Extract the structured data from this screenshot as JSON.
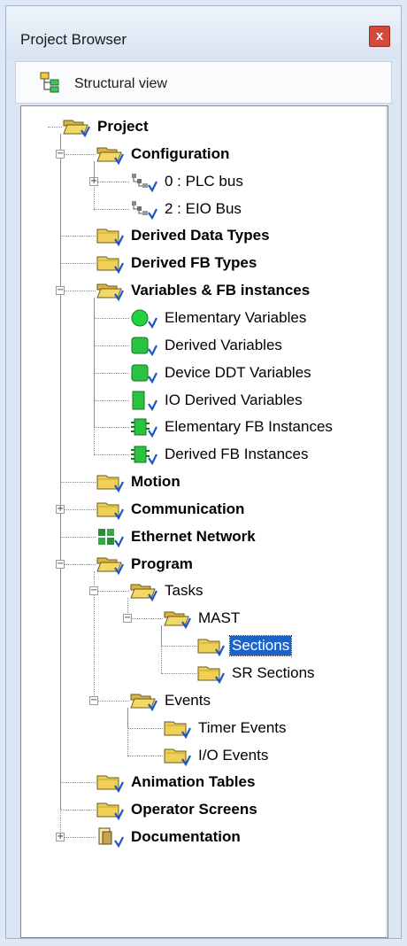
{
  "panel": {
    "title": "Project Browser",
    "close_label": "x"
  },
  "view": {
    "label": "Structural view",
    "icon": "structural-view-icon"
  },
  "tree": [
    {
      "id": "project",
      "label": "Project",
      "bold": true,
      "depth": 0,
      "icon": "folder-open",
      "expander": null
    },
    {
      "id": "configuration",
      "label": "Configuration",
      "bold": true,
      "depth": 1,
      "icon": "folder-open",
      "expander": "-"
    },
    {
      "id": "plc-bus",
      "label": "0 : PLC bus",
      "bold": false,
      "depth": 2,
      "icon": "bus",
      "expander": "+"
    },
    {
      "id": "eio-bus",
      "label": "2 : EIO Bus",
      "bold": false,
      "depth": 2,
      "icon": "bus",
      "expander": null
    },
    {
      "id": "derived-data-types",
      "label": "Derived Data Types",
      "bold": true,
      "depth": 1,
      "icon": "folder",
      "expander": null
    },
    {
      "id": "derived-fb-types",
      "label": "Derived FB Types",
      "bold": true,
      "depth": 1,
      "icon": "folder",
      "expander": null
    },
    {
      "id": "variables-fb-instances",
      "label": "Variables & FB instances",
      "bold": true,
      "depth": 1,
      "icon": "folder-open",
      "expander": "-"
    },
    {
      "id": "elementary-variables",
      "label": "Elementary Variables",
      "bold": false,
      "depth": 2,
      "icon": "var-circle",
      "expander": null
    },
    {
      "id": "derived-variables",
      "label": "Derived Variables",
      "bold": false,
      "depth": 2,
      "icon": "var-square",
      "expander": null
    },
    {
      "id": "device-ddt-variables",
      "label": "Device DDT Variables",
      "bold": false,
      "depth": 2,
      "icon": "var-square",
      "expander": null
    },
    {
      "id": "io-derived-variables",
      "label": "IO Derived Variables",
      "bold": false,
      "depth": 2,
      "icon": "var-io",
      "expander": null
    },
    {
      "id": "elementary-fb-instances",
      "label": "Elementary FB Instances",
      "bold": false,
      "depth": 2,
      "icon": "fb",
      "expander": null
    },
    {
      "id": "derived-fb-instances",
      "label": "Derived FB Instances",
      "bold": false,
      "depth": 2,
      "icon": "fb",
      "expander": null
    },
    {
      "id": "motion",
      "label": "Motion",
      "bold": true,
      "depth": 1,
      "icon": "folder",
      "expander": null
    },
    {
      "id": "communication",
      "label": "Communication",
      "bold": true,
      "depth": 1,
      "icon": "folder",
      "expander": "+"
    },
    {
      "id": "ethernet-network",
      "label": "Ethernet Network",
      "bold": true,
      "depth": 1,
      "icon": "network",
      "expander": null
    },
    {
      "id": "program",
      "label": "Program",
      "bold": true,
      "depth": 1,
      "icon": "folder-open",
      "expander": "-"
    },
    {
      "id": "tasks",
      "label": "Tasks",
      "bold": false,
      "depth": 2,
      "icon": "folder-open",
      "expander": "-"
    },
    {
      "id": "mast",
      "label": "MAST",
      "bold": false,
      "depth": 3,
      "icon": "folder-open",
      "expander": "-"
    },
    {
      "id": "sections",
      "label": "Sections",
      "bold": false,
      "depth": 4,
      "icon": "folder",
      "expander": null,
      "selected": true
    },
    {
      "id": "sr-sections",
      "label": "SR Sections",
      "bold": false,
      "depth": 4,
      "icon": "folder",
      "expander": null
    },
    {
      "id": "events",
      "label": "Events",
      "bold": false,
      "depth": 2,
      "icon": "folder-open",
      "expander": "-"
    },
    {
      "id": "timer-events",
      "label": "Timer Events",
      "bold": false,
      "depth": 3,
      "icon": "folder",
      "expander": null
    },
    {
      "id": "io-events",
      "label": "I/O Events",
      "bold": false,
      "depth": 3,
      "icon": "folder",
      "expander": null
    },
    {
      "id": "animation-tables",
      "label": "Animation Tables",
      "bold": true,
      "depth": 1,
      "icon": "folder",
      "expander": null
    },
    {
      "id": "operator-screens",
      "label": "Operator Screens",
      "bold": true,
      "depth": 1,
      "icon": "folder",
      "expander": null
    },
    {
      "id": "documentation",
      "label": "Documentation",
      "bold": true,
      "depth": 1,
      "icon": "doc",
      "expander": "+"
    }
  ]
}
